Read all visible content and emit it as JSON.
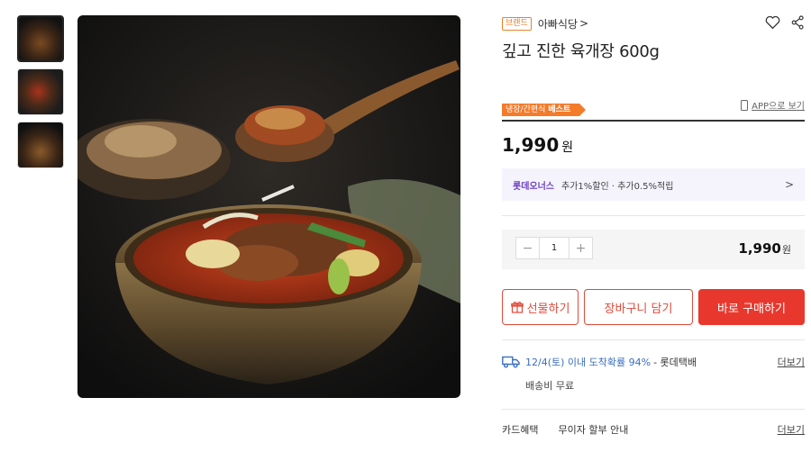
{
  "gallery": {
    "thumbnails": [
      "thumbnail-1",
      "thumbnail-2",
      "thumbnail-3"
    ]
  },
  "product": {
    "brand_badge": "브랜드",
    "brand_name": "아빠식당",
    "brand_arrow": ">",
    "title": "깊고 진한 육개장 600g",
    "tag_prefix": "냉장/간편식",
    "tag_strong": "베스트",
    "app_link": "APP으로 보기",
    "price": "1,990",
    "currency": "원"
  },
  "membership": {
    "name": "롯데오너스",
    "benefit": "추가1%할인 · 추가0.5%적립",
    "arrow": ">"
  },
  "quantity": {
    "minus": "−",
    "value": "1",
    "plus": "+",
    "total": "1,990",
    "currency": "원"
  },
  "buttons": {
    "gift": "선물하기",
    "cart": "장바구니 담기",
    "buy": "바로 구매하기"
  },
  "shipping": {
    "eta": "12/4(토) 이내 도착확률 94%",
    "carrier": "- 롯데택배",
    "more": "더보기",
    "fee": "배송비 무료"
  },
  "card": {
    "label": "카드혜택",
    "text": "무이자 할부 안내",
    "more": "더보기"
  },
  "colors": {
    "accent": "#e8382e",
    "tag": "#f47b2a",
    "member": "#6b3fc4",
    "shipping": "#3a6ec2"
  }
}
